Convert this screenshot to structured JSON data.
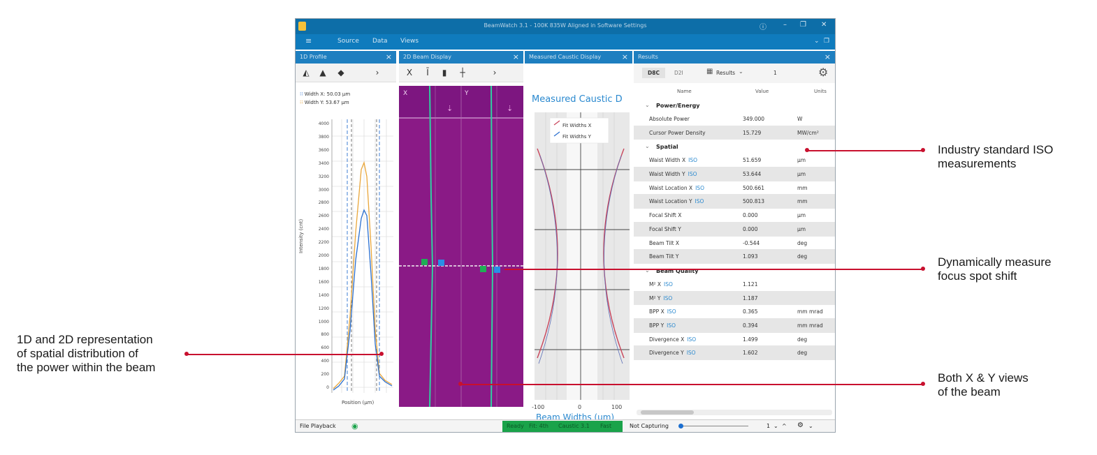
{
  "window": {
    "title": "BeamWatch 3.1 - 100K 835W Aligned in Software Settings",
    "menu": [
      "Source",
      "Data",
      "Views"
    ]
  },
  "panels": {
    "profile": {
      "title": "1D Profile",
      "legend_x": "Width X: 50.03 µm",
      "legend_y": "Width Y: 53.67 µm",
      "ylabel": "Intensity (cnt)",
      "xlabel": "Position (µm)",
      "y_ticks": [
        "4000",
        "3800",
        "3600",
        "3400",
        "3200",
        "3000",
        "2800",
        "2600",
        "2400",
        "2200",
        "2000",
        "1800",
        "1600",
        "1400",
        "1200",
        "1000",
        "800",
        "600",
        "400",
        "200",
        "0"
      ]
    },
    "beam2d": {
      "title": "2D Beam Display",
      "x_label": "X",
      "y_label": "Y"
    },
    "caustic": {
      "title": "Measured Caustic Display",
      "plot_title": "Measured Caustic D",
      "legend": [
        "Fit Widths X",
        "Fit Widths Y"
      ],
      "x_ticks": [
        "-100",
        "0",
        "100"
      ],
      "xlabel": "Beam Widths (um)"
    },
    "results": {
      "title": "Results",
      "tabs": [
        "D8C",
        "D2I",
        "Results"
      ],
      "tab_count": "1",
      "columns": [
        "Name",
        "Value",
        "Units"
      ],
      "sections": [
        {
          "name": "Power/Energy",
          "rows": [
            {
              "name": "Absolute Power",
              "iso": "",
              "value": "349.000",
              "unit": "W"
            },
            {
              "name": "Cursor Power Density",
              "iso": "",
              "value": "15.729",
              "unit": "MW/cm²"
            }
          ]
        },
        {
          "name": "Spatial",
          "rows": [
            {
              "name": "Waist Width X",
              "iso": "ISO",
              "value": "51.659",
              "unit": "µm"
            },
            {
              "name": "Waist Width Y",
              "iso": "ISO",
              "value": "53.644",
              "unit": "µm"
            },
            {
              "name": "Waist Location X",
              "iso": "ISO",
              "value": "500.661",
              "unit": "mm"
            },
            {
              "name": "Waist Location Y",
              "iso": "ISO",
              "value": "500.813",
              "unit": "mm"
            },
            {
              "name": "Focal Shift X",
              "iso": "",
              "value": "0.000",
              "unit": "µm"
            },
            {
              "name": "Focal Shift Y",
              "iso": "",
              "value": "0.000",
              "unit": "µm"
            },
            {
              "name": "Beam Tilt X",
              "iso": "",
              "value": "-0.544",
              "unit": "deg"
            },
            {
              "name": "Beam Tilt Y",
              "iso": "",
              "value": "1.093",
              "unit": "deg"
            }
          ]
        },
        {
          "name": "Beam Quality",
          "rows": [
            {
              "name": "M² X",
              "iso": "ISO",
              "value": "1.121",
              "unit": ""
            },
            {
              "name": "M² Y",
              "iso": "ISO",
              "value": "1.187",
              "unit": ""
            },
            {
              "name": "BPP X",
              "iso": "ISO",
              "value": "0.365",
              "unit": "mm mrad"
            },
            {
              "name": "BPP Y",
              "iso": "ISO",
              "value": "0.394",
              "unit": "mm mrad"
            },
            {
              "name": "Divergence X",
              "iso": "ISO",
              "value": "1.499",
              "unit": "deg"
            },
            {
              "name": "Divergence Y",
              "iso": "ISO",
              "value": "1.602",
              "unit": "deg"
            }
          ]
        }
      ]
    }
  },
  "status": {
    "playback": "File Playback",
    "green": [
      "Ready",
      "Fit: 4th",
      "Caustic 3.1",
      "Fast"
    ],
    "capture": "Not Capturing",
    "count": "1"
  },
  "annotations": {
    "iso": [
      "Industry standard ISO",
      "measurements"
    ],
    "focus": [
      "Dynamically measure",
      "focus spot shift"
    ],
    "repr": [
      "1D and 2D representation",
      "of spatial distribution of",
      "the power within the beam"
    ],
    "views": [
      "Both X & Y views",
      "of the beam"
    ]
  },
  "colors": {
    "titlebar": "#0d6ea8",
    "beam_bg": "#8a1a86",
    "annotation_line": "#c8102e",
    "green_status": "#1aa34a"
  }
}
